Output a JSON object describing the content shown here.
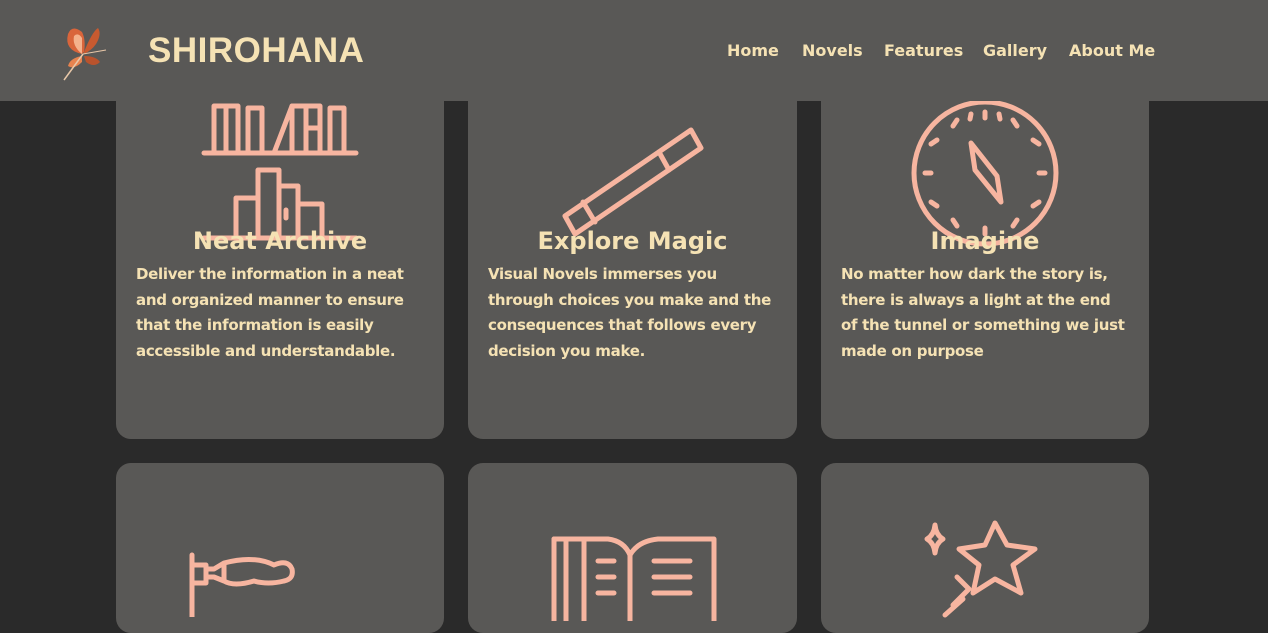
{
  "site": {
    "brand": "SHIROHANA",
    "logo_icon": "butterfly-icon"
  },
  "nav": {
    "items": [
      {
        "label": "Home"
      },
      {
        "label": "Novels"
      },
      {
        "label": "Features"
      },
      {
        "label": "Gallery"
      },
      {
        "label": "About Me"
      }
    ]
  },
  "features": [
    {
      "icon": "archive-books-icon",
      "title": "Neat Archive",
      "description": "Deliver the information in a neat and organized manner to ensure that the information is easily accessible and understandable."
    },
    {
      "icon": "magic-wand-icon",
      "title": "Explore Magic",
      "description": "Visual Novels immerses you through choices you make and the consequences that follows every decision you make."
    },
    {
      "icon": "compass-icon",
      "title": "Imagine",
      "description": "No matter how dark the story is, there is always a light at the end of the tunnel or something we just made on purpose"
    },
    {
      "icon": "paintbrush-icon"
    },
    {
      "icon": "open-book-icon"
    },
    {
      "icon": "stars-icon"
    }
  ],
  "colors": {
    "header_bg": "#595856",
    "page_bg": "#2a2a2a",
    "card_bg": "#595856",
    "text_cream": "#f5e2b4",
    "icon_salmon": "#f7b5a0"
  }
}
